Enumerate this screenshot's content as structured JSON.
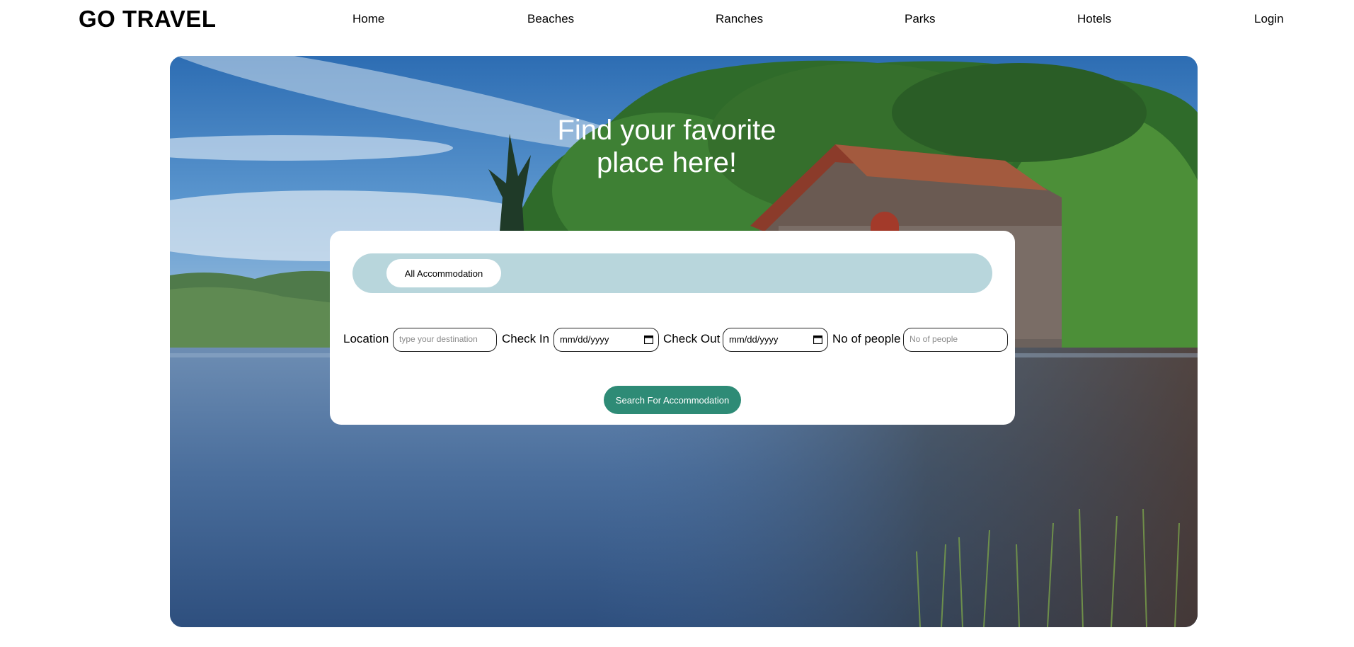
{
  "header": {
    "brand": "GO TRAVEL",
    "nav": [
      "Home",
      "Beaches",
      "Ranches",
      "Parks",
      "Hotels",
      "Login"
    ]
  },
  "hero": {
    "headline_line1": "Find your favorite",
    "headline_line2": "place here!"
  },
  "search": {
    "tab_label": "All Accommodation",
    "location_label": "Location",
    "location_placeholder": "type your destination",
    "checkin_label": "Check In",
    "checkin_value": "mm/dd/yyyy",
    "checkout_label": "Check Out",
    "checkout_value": "mm/dd/yyyy",
    "people_label": "No of people",
    "people_placeholder": "No of people",
    "button_label": "Search For Accommodation"
  },
  "colors": {
    "accent_button": "#2e8b76",
    "tab_strip": "#b8d6dc"
  },
  "icons": {
    "date_picker": "calendar-icon"
  }
}
